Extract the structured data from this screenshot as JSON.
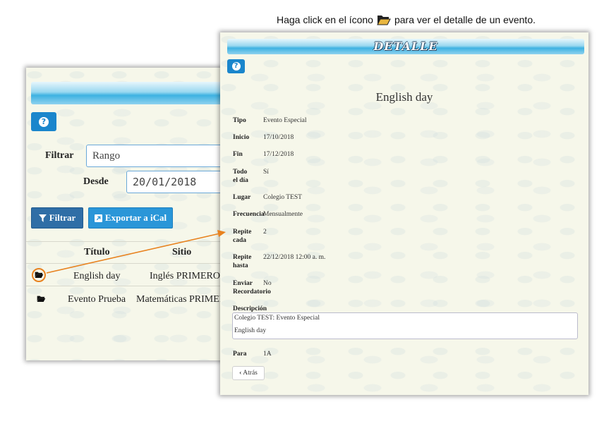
{
  "caption": {
    "before": "Haga click en el ícono",
    "after": "para ver el detalle de un evento."
  },
  "list_panel": {
    "filter_label": "Filtrar",
    "filter_value": "Rango",
    "from_label": "Desde",
    "from_value": "20/01/2018",
    "filter_button": "Filtrar",
    "export_button": "Exportar a iCal",
    "columns": [
      "Título",
      "Sitio"
    ],
    "rows": [
      {
        "title": "English day",
        "site": "Inglés PRIMERO"
      },
      {
        "title": "Evento Prueba",
        "site": "Matemáticas PRIMERO"
      }
    ]
  },
  "detail_panel": {
    "header": "DETALLE",
    "event_title": "English day",
    "fields": {
      "tipo_label": "Tipo",
      "tipo": "Evento Especial",
      "inicio_label": "Inicio",
      "inicio": "17/10/2018",
      "fin_label": "Fin",
      "fin": "17/12/2018",
      "todo_label_1": "Todo",
      "todo_label_2": "el día",
      "todo": "Sí",
      "lugar_label": "Lugar",
      "lugar": "Colegio TEST",
      "frecuencia_label": "Frecuencia",
      "frecuencia": "Mensualmente",
      "repite_label_1": "Repite",
      "repite_label_2": "cada",
      "repite": "2",
      "hasta_label_1": "Repite",
      "hasta_label_2": "hasta",
      "hasta": "22/12/2018 12:00 a. m.",
      "recordatorio_label_1": "Enviar",
      "recordatorio_label_2": "Recordatorio",
      "recordatorio": "No",
      "descripcion_label": "Descripción",
      "descripcion_line1": "Colegio TEST: Evento Especial",
      "descripcion_line2": "English day",
      "para_label": "Para",
      "para": "1A"
    },
    "back_button": "Atrás"
  },
  "colors": {
    "accent_blue": "#1a86cc",
    "arrow_orange": "#e8821f",
    "panel_bg": "#f6f7ea"
  }
}
